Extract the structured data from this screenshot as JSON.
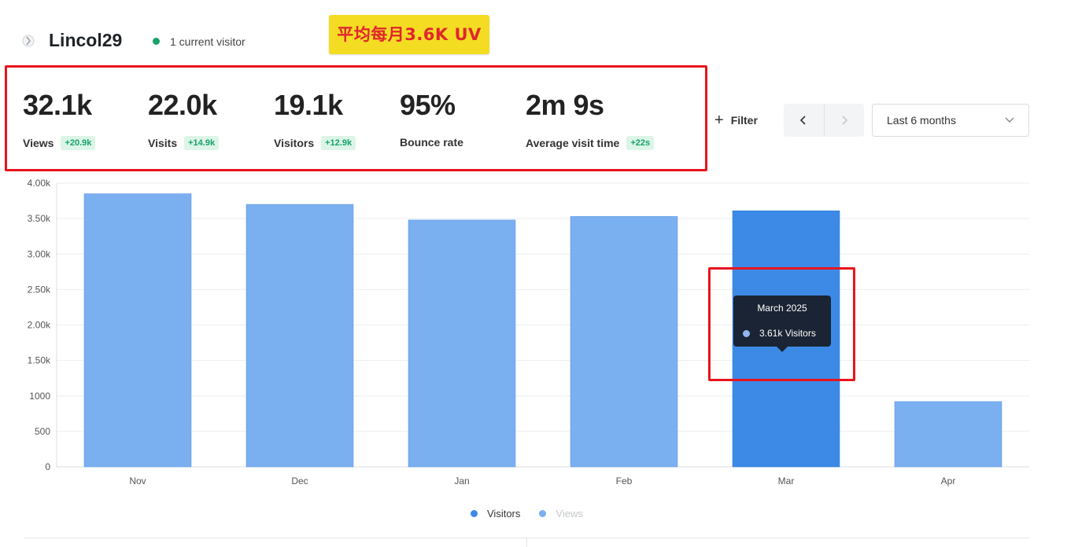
{
  "header": {
    "site_name": "Lincol29",
    "current_visitors": "1 current visitor",
    "live_color": "#16a36a",
    "logo_icon": "site-favicon-icon"
  },
  "annotation_banner": {
    "text": "平均每月3.6K UV",
    "background": "#f4dc23",
    "text_color": "#e0262c"
  },
  "stats": [
    {
      "value": "32.1k",
      "label": "Views",
      "delta": "+20.9k"
    },
    {
      "value": "22.0k",
      "label": "Visits",
      "delta": "+14.9k"
    },
    {
      "value": "19.1k",
      "label": "Visitors",
      "delta": "+12.9k"
    },
    {
      "value": "95%",
      "label": "Bounce rate",
      "delta": ""
    },
    {
      "value": "2m 9s",
      "label": "Average visit time",
      "delta": "+22s"
    }
  ],
  "controls": {
    "filter_label": "Filter",
    "filter_icon": "plus-icon",
    "prev_icon": "chevron-left-icon",
    "next_icon": "chevron-right-icon",
    "date_range": "Last 6 months",
    "dropdown_icon": "chevron-down-icon"
  },
  "chart_data": {
    "type": "bar",
    "categories": [
      "Nov",
      "Dec",
      "Jan",
      "Feb",
      "Mar",
      "Apr"
    ],
    "series": [
      {
        "name": "Visitors",
        "values": [
          3850,
          3700,
          3480,
          3530,
          3610,
          920
        ],
        "color": "#7aaff0",
        "highlight_color": "#3d8ae6"
      },
      {
        "name": "Views",
        "values": [],
        "color": "#7aaff0"
      }
    ],
    "ylim": [
      0,
      4000
    ],
    "yticks": [
      0,
      500,
      1000,
      1500,
      2000,
      2500,
      3000,
      3500,
      4000
    ],
    "ytick_labels": [
      "0",
      "500",
      "1000",
      "1.50k",
      "2.00k",
      "2.50k",
      "3.00k",
      "3.50k",
      "4.00k"
    ],
    "grid": true,
    "highlighted_category": "Mar",
    "legend_position": "bottom-center"
  },
  "tooltip": {
    "title": "March 2025",
    "text": "3.61k Visitors",
    "swatch_color": "#8fb6f0"
  },
  "legend": [
    {
      "label": "Visitors",
      "color": "#3d8ae6",
      "text_color": "#333333"
    },
    {
      "label": "Views",
      "color": "#7aaff0",
      "text_color": "#c4c7ca"
    }
  ]
}
